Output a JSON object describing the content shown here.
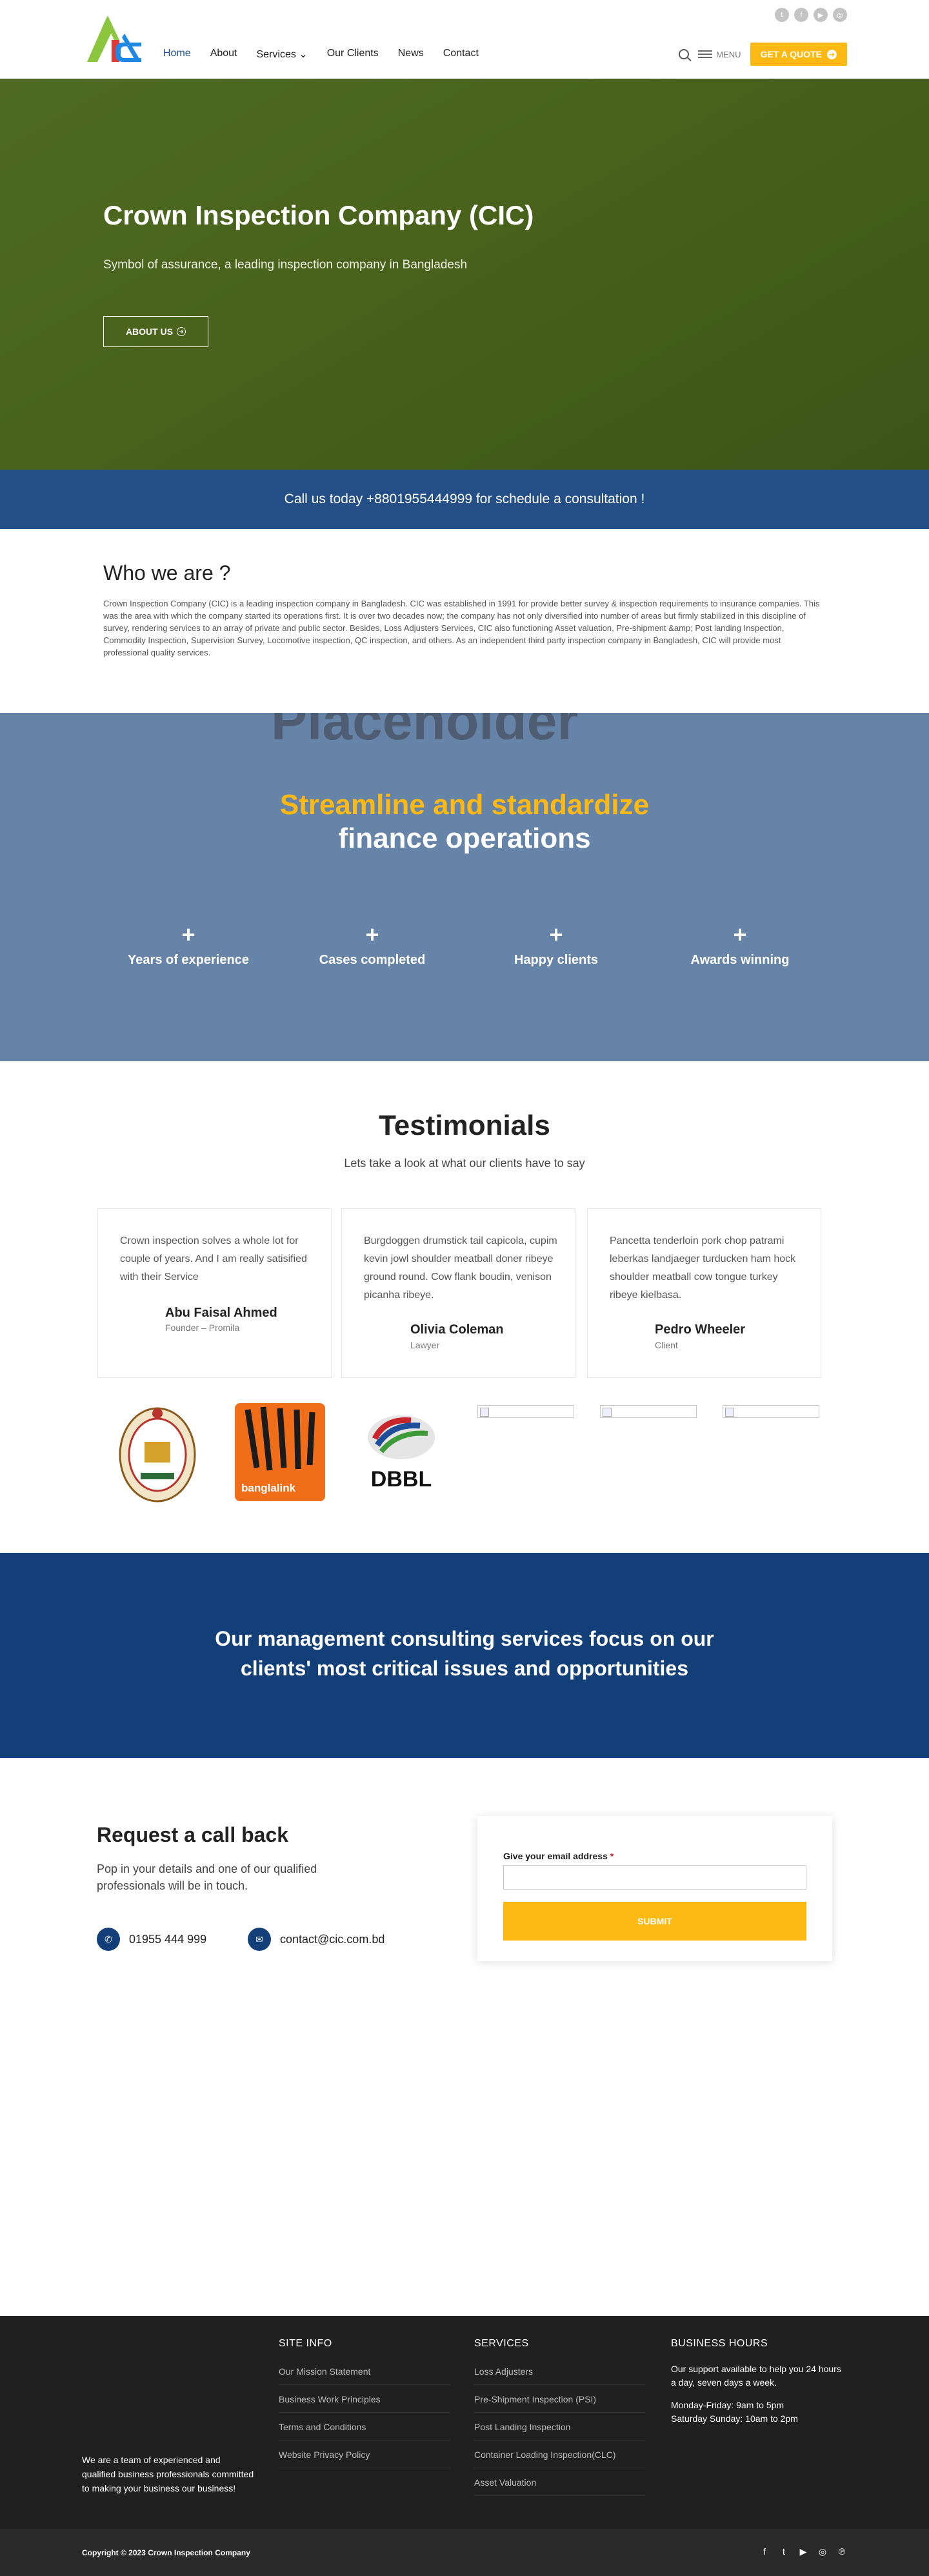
{
  "header": {
    "nav": [
      {
        "label": "Home",
        "active": true
      },
      {
        "label": "About"
      },
      {
        "label": "Services ⌄"
      },
      {
        "label": "Our Clients"
      },
      {
        "label": "News"
      },
      {
        "label": "Contact"
      }
    ],
    "menu_label": "MENU",
    "quote_label": "GET A QUOTE",
    "social_top": [
      "twitter-icon",
      "facebook-icon",
      "youtube-icon",
      "instagram-icon"
    ]
  },
  "hero": {
    "title": "Crown Inspection Company (CIC)",
    "subtitle": "Symbol of assurance, a leading inspection company in Bangladesh",
    "button": "ABOUT US"
  },
  "callbar": {
    "text": "Call us today +8801955444999 for schedule a consultation !"
  },
  "who": {
    "title": "Who we are ?",
    "body": "Crown Inspection Company (CIC) is a leading inspection company in Bangladesh. CIC was established in 1991 for provide better survey & inspection requirements to insurance companies. This was the area with which the company started its operations first. It is over two decades now; the company has not only diversified into number of areas but firmly stabilized in this discipline of survey, rendering services to an array of private and public sector. Besides, Loss Adjusters Services, CIC also functioning Asset valuation, Pre-shipment &amp; Post landing Inspection, Commodity Inspection, Supervision Survey, Locomotive inspection, QC inspection, and others. As an independent third party inspection company in Bangladesh, CIC will provide most professional quality services."
  },
  "stats": {
    "watermark": "Placeholder",
    "heading_yellow": "Streamline and standardize",
    "heading_white": "finance operations",
    "items": [
      {
        "plus": "+",
        "label": "Years of experience"
      },
      {
        "plus": "+",
        "label": "Cases completed"
      },
      {
        "plus": "+",
        "label": "Happy clients"
      },
      {
        "plus": "+",
        "label": "Awards winning"
      }
    ]
  },
  "testimonials": {
    "title": "Testimonials",
    "subtitle": "Lets take a look at what our clients have to say",
    "cards": [
      {
        "quote": "Crown inspection solves a whole lot for couple of years. And I am really satisified with their Service",
        "name": "Abu Faisal Ahmed",
        "role": "Founder – Promila"
      },
      {
        "quote": "Burgdoggen drumstick tail capicola, cupim kevin jowl shoulder meatball doner ribeye ground round. Cow flank boudin, venison picanha ribeye.",
        "name": "Olivia Coleman",
        "role": "Lawyer"
      },
      {
        "quote": "Pancetta tenderloin pork chop patrami leberkas landjaeger turducken ham hock shoulder meatball cow tongue turkey ribeye kielbasa.",
        "name": "Pedro Wheeler",
        "role": "Client"
      }
    ]
  },
  "clients": {
    "banglalink": "banglalink",
    "dbbl": "DBBL"
  },
  "consult": {
    "line1": "Our management consulting services focus on our",
    "line2": "clients' most critical issues and opportunities"
  },
  "callback": {
    "title": "Request a call back",
    "text": "Pop in your details and one of our qualified professionals will be in touch.",
    "phone": "01955 444 999",
    "email": "contact@cic.com.bd",
    "email_label": "Give your email address",
    "required": "*",
    "submit": "SUBMIT"
  },
  "footer": {
    "about": "We are a team of experienced and qualified business professionals committed to making your business our business!",
    "site_info": {
      "title": "SITE INFO",
      "links": [
        "Our Mission Statement",
        "Business Work Principles",
        "Terms and Conditions",
        "Website Privacy Policy"
      ]
    },
    "services": {
      "title": "SERVICES",
      "links": [
        "Loss Adjusters",
        "Pre-Shipment Inspection (PSI)",
        "Post Landing Inspection",
        "Container Loading Inspection(CLC)",
        "Asset Valuation"
      ]
    },
    "hours": {
      "title": "BUSINESS HOURS",
      "text1": "Our support available to help you 24 hours a day, seven days a week.",
      "text2": "Monday-Friday: 9am to 5pm",
      "text3": "Saturday Sunday: 10am to 2pm"
    },
    "copyright": "Copyright © 2023 Crown Inspection Company",
    "social": [
      "facebook-icon",
      "twitter-icon",
      "youtube-icon",
      "instagram-icon",
      "pinterest-icon"
    ]
  }
}
